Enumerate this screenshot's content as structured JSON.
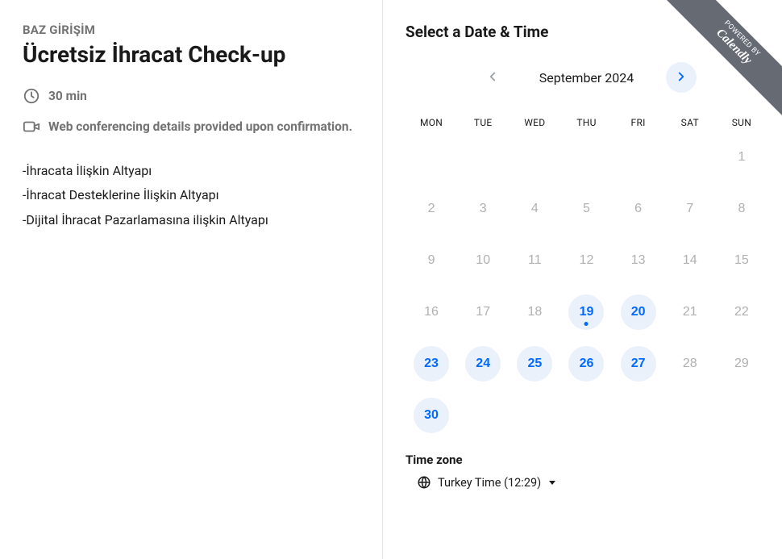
{
  "left": {
    "organizer": "BAZ GİRİŞİM",
    "title": "Ücretsiz İhracat Check-up",
    "duration": "30 min",
    "conferencing": "Web conferencing details provided upon confirmation.",
    "desc_lines": [
      "-İhracata İlişkin Altyapı",
      "-İhracat Desteklerine İlişkin Altyapı",
      "-Dijital İhracat Pazarlamasına ilişkin Altyapı"
    ]
  },
  "right": {
    "heading": "Select a Date & Time",
    "month_label": "September 2024",
    "weekdays": [
      "MON",
      "TUE",
      "WED",
      "THU",
      "FRI",
      "SAT",
      "SUN"
    ],
    "days": [
      {
        "n": "",
        "state": "blank"
      },
      {
        "n": "",
        "state": "blank"
      },
      {
        "n": "",
        "state": "blank"
      },
      {
        "n": "",
        "state": "blank"
      },
      {
        "n": "",
        "state": "blank"
      },
      {
        "n": "",
        "state": "blank"
      },
      {
        "n": "1",
        "state": "dim"
      },
      {
        "n": "2",
        "state": "dim"
      },
      {
        "n": "3",
        "state": "dim"
      },
      {
        "n": "4",
        "state": "dim"
      },
      {
        "n": "5",
        "state": "dim"
      },
      {
        "n": "6",
        "state": "dim"
      },
      {
        "n": "7",
        "state": "dim"
      },
      {
        "n": "8",
        "state": "dim"
      },
      {
        "n": "9",
        "state": "dim"
      },
      {
        "n": "10",
        "state": "dim"
      },
      {
        "n": "11",
        "state": "dim"
      },
      {
        "n": "12",
        "state": "dim"
      },
      {
        "n": "13",
        "state": "dim"
      },
      {
        "n": "14",
        "state": "dim"
      },
      {
        "n": "15",
        "state": "dim"
      },
      {
        "n": "16",
        "state": "dim"
      },
      {
        "n": "17",
        "state": "dim"
      },
      {
        "n": "18",
        "state": "dim"
      },
      {
        "n": "19",
        "state": "available",
        "today": true
      },
      {
        "n": "20",
        "state": "available"
      },
      {
        "n": "21",
        "state": "dim"
      },
      {
        "n": "22",
        "state": "dim"
      },
      {
        "n": "23",
        "state": "available"
      },
      {
        "n": "24",
        "state": "available"
      },
      {
        "n": "25",
        "state": "available"
      },
      {
        "n": "26",
        "state": "available"
      },
      {
        "n": "27",
        "state": "available"
      },
      {
        "n": "28",
        "state": "dim"
      },
      {
        "n": "29",
        "state": "dim"
      },
      {
        "n": "30",
        "state": "available"
      }
    ],
    "tz_label": "Time zone",
    "tz_value": "Turkey Time (12:29)"
  },
  "badge": {
    "powered": "POWERED BY",
    "brand": "Calendly"
  }
}
